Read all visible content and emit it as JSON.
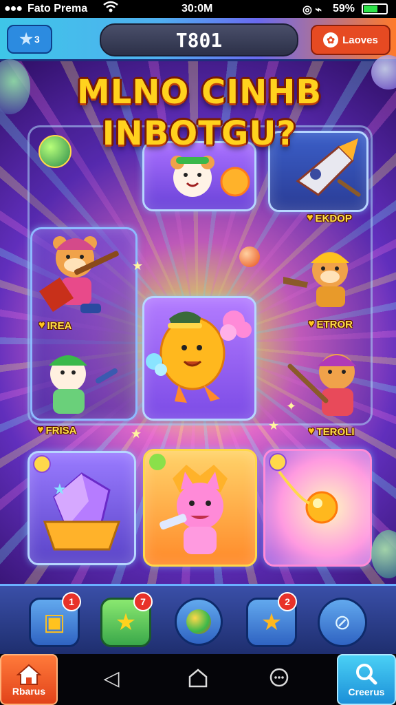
{
  "status_bar": {
    "carrier": "Fato Prema",
    "time": "30:0M",
    "battery": "59%",
    "signal_dots": "●●●"
  },
  "header": {
    "star_count": "3",
    "title": "T801",
    "leaves_label": "Laoves"
  },
  "headline": {
    "line1": "MLNO CINHB",
    "line2": "INBOTGU?"
  },
  "characters": [
    {
      "name": "EKDOP"
    },
    {
      "name": "IREA"
    },
    {
      "name": "ETROR"
    },
    {
      "name": "FRISA"
    },
    {
      "name": "TEROLI"
    }
  ],
  "tray": {
    "items": [
      {
        "icon": "gift-box-icon",
        "badge": "1"
      },
      {
        "icon": "star-icon",
        "badge": "7"
      },
      {
        "icon": "orb-icon",
        "badge": ""
      },
      {
        "icon": "star-icon",
        "badge": "2"
      },
      {
        "icon": "no-ads-icon",
        "badge": ""
      }
    ]
  },
  "nav": {
    "home_label": "Rbarus",
    "search_label": "Creerus"
  },
  "colors": {
    "accent_orange": "#e64a22",
    "accent_blue": "#2c8be0",
    "headline_yellow": "#ffd21e"
  }
}
